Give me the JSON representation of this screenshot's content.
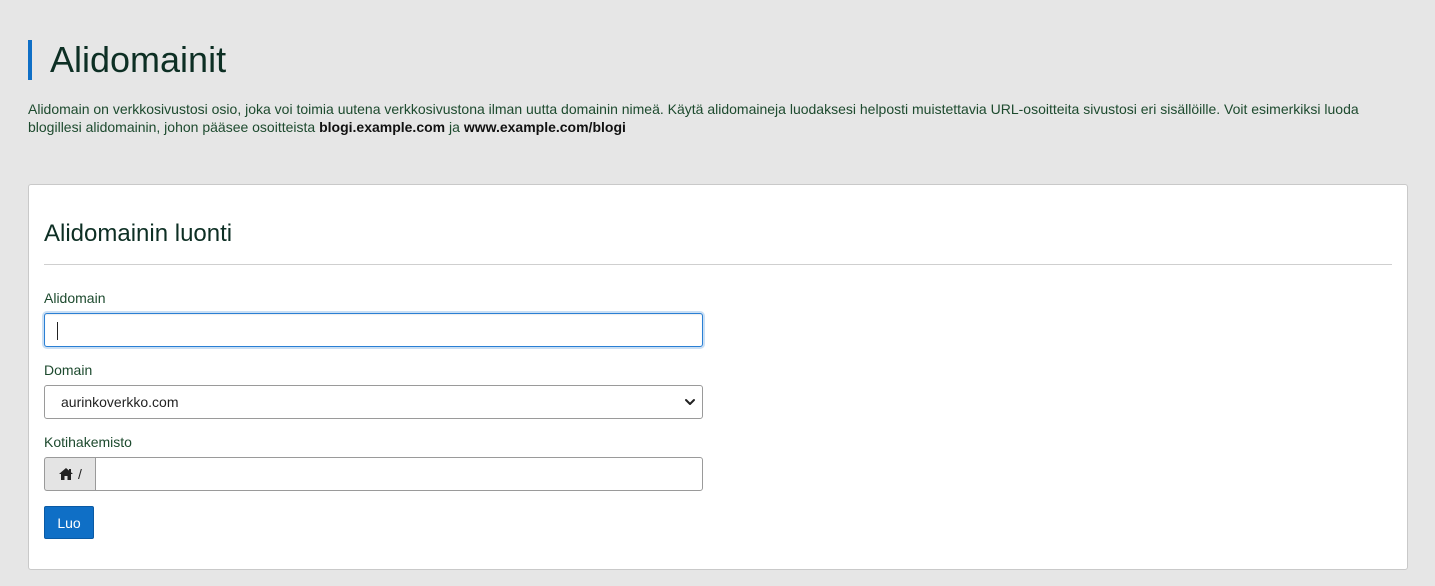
{
  "page": {
    "title": "Alidomainit",
    "description_text": "Alidomain on verkkosivustosi osio, joka voi toimia uutena verkkosivustona ilman uutta domainin nimeä. Käytä alidomaineja luodaksesi helposti muistettavia URL-osoitteita sivustosi eri sisällöille. Voit esimerkiksi luoda blogillesi alidomainin, johon pääsee osoitteista ",
    "description_example1": "blogi.example.com",
    "description_join": " ja ",
    "description_example2": "www.example.com/blogi"
  },
  "form": {
    "title": "Alidomainin luonti",
    "subdomain_label": "Alidomain",
    "subdomain_value": "",
    "domain_label": "Domain",
    "domain_selected": "aurinkoverkko.com",
    "home_dir_label": "Kotihakemisto",
    "home_dir_prefix": "/",
    "home_dir_value": "",
    "submit_label": "Luo"
  },
  "icons": {
    "home": "home-icon",
    "chevron": "chevron-down-icon"
  },
  "colors": {
    "accent": "#0f6fc6",
    "background": "#e6e6e6",
    "text": "#0d2f24"
  }
}
